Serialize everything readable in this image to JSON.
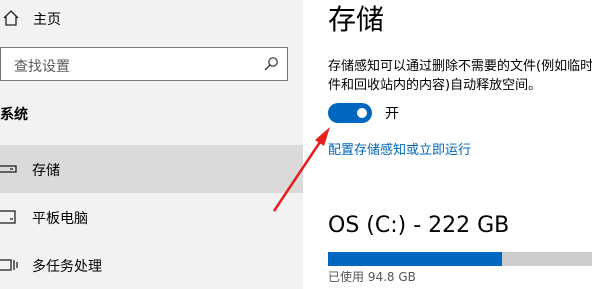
{
  "sidebar": {
    "home_label": "主页",
    "search_placeholder": "查找设置",
    "section_title": "系统",
    "items": [
      {
        "label": "存储",
        "icon": "storage-icon",
        "selected": true
      },
      {
        "label": "平板电脑",
        "icon": "tablet-icon",
        "selected": false
      },
      {
        "label": "多任务处理",
        "icon": "multitasking-icon",
        "selected": false
      }
    ]
  },
  "main": {
    "title": "存储",
    "description": "存储感知可以通过删除不需要的文件(例如临时文件和回收站内的内容)自动释放空间。",
    "toggle": {
      "on": true,
      "label": "开"
    },
    "config_link": "配置存储感知或立即运行",
    "drive": {
      "title": "OS (C:) - 222 GB",
      "used_label": "已使用 94.8 GB",
      "used_fraction": 0.62
    }
  },
  "colors": {
    "accent": "#0067c0",
    "link": "#0067b8",
    "sidebar_bg": "#f2f2f2",
    "selected_bg": "#dadada",
    "annotation_arrow": "#e8201d"
  }
}
